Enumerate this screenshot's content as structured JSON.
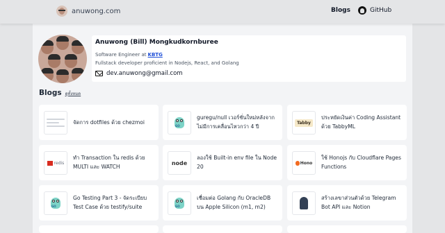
{
  "header": {
    "site_name": "anuwong.com",
    "nav": {
      "blogs": "Blogs",
      "github": "GitHub"
    }
  },
  "profile": {
    "name": "Anuwong (Bill) Mongkudkornburee",
    "title_prefix": "Software Engineer at",
    "company": "KBTG",
    "description": "Fullstack developer proficient in Nodejs, React, and Golang",
    "email": "dev.anuwong@gmail.com"
  },
  "blogs": {
    "heading": "Blogs",
    "see_all": "ดูทั้งหมด",
    "cards": [
      {
        "title": "จัดการ dotfiles ด้วย chezmoi",
        "thumb": "dotfiles-lines",
        "thumb_text": ""
      },
      {
        "title": "guregu/null เวอร์ชั่นใหม่หลังจากไม่มีการเคลื่อนไหวกว่า 4 ปี",
        "thumb": "go-gopher",
        "thumb_text": "GO"
      },
      {
        "title": "ประหยัดเงินค่า Coding Assistant ด้วย TabbyML",
        "thumb": "tabby-logo",
        "thumb_text": "Tabby"
      },
      {
        "title": "ทำ Transaction ใน redis ด้วย MULTI และ WATCH",
        "thumb": "redis-logo",
        "thumb_text": "redis"
      },
      {
        "title": "ลองใช้ Built-in env file ใน Node 20",
        "thumb": "node-logo",
        "thumb_text": "node"
      },
      {
        "title": "ใช้ Honojs กับ Cloudflare Pages Functions",
        "thumb": "hono-logo",
        "thumb_text": "Hono"
      },
      {
        "title": "Go Testing Part 3 - จัดระเบียบ Test Case ด้วย testify/suite",
        "thumb": "go-gopher",
        "thumb_text": "GO"
      },
      {
        "title": "เชื่อมต่อ Golang กับ OracleDB บน Apple Silicon (m1, m2)",
        "thumb": "go-gopher",
        "thumb_text": "GO"
      },
      {
        "title": "สร้างเลขาส่วนตัวด้วย Telegram Bot API และ Notion",
        "thumb": "person-photo",
        "thumb_text": ""
      }
    ]
  },
  "colors": {
    "page_bg": "#e4e5e7",
    "content_bg": "#f3f4f6",
    "card_bg": "#ffffff",
    "link_blue": "#1d4ed8",
    "redis_red": "#d82c20",
    "node_green": "#539e43",
    "hono_orange": "#f26b21"
  }
}
